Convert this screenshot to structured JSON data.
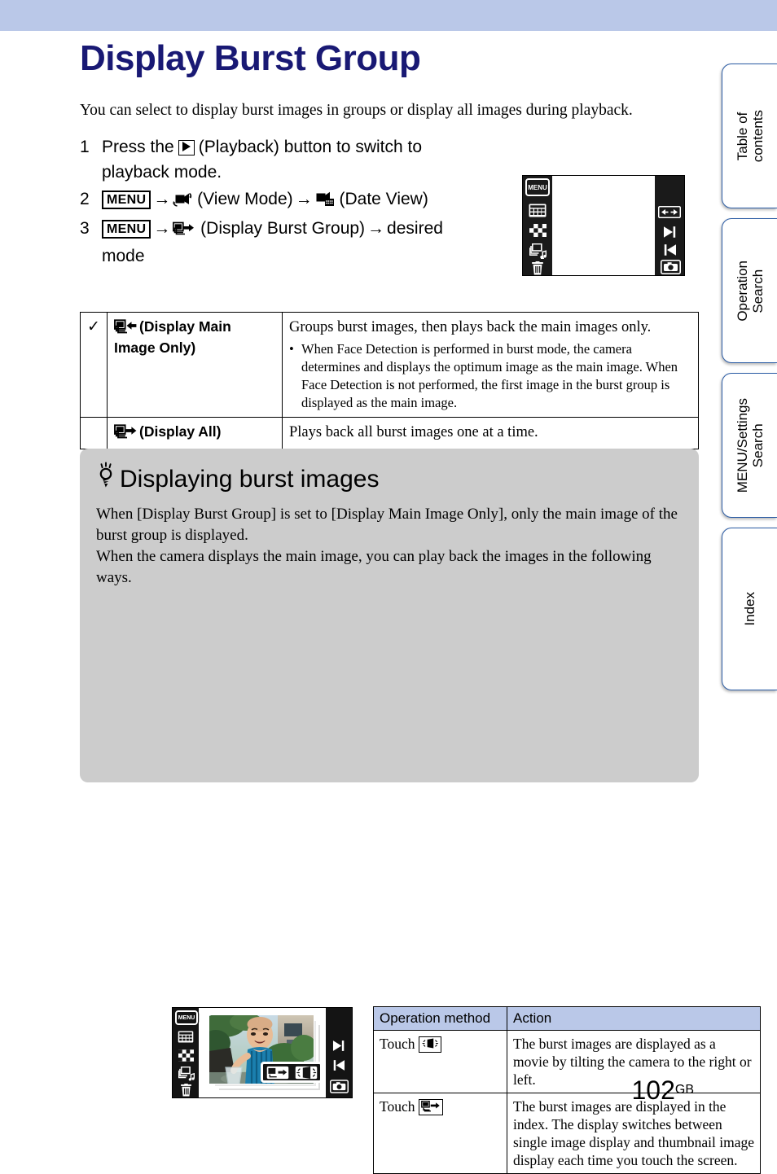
{
  "document": {
    "title": "Display Burst Group",
    "intro": "You can select to display burst images in groups or display all images during playback.",
    "page_number": "102",
    "page_suffix": "GB"
  },
  "side_tabs": [
    {
      "label": "Table of\ncontents"
    },
    {
      "label": "Operation\nSearch"
    },
    {
      "label": "MENU/Settings\nSearch"
    },
    {
      "label": "Index"
    }
  ],
  "steps": [
    {
      "num": "1",
      "line1_a": "Press the",
      "icon1": "playback-icon",
      "line1_b": "(Playback) button to switch to",
      "line2": "playback mode."
    },
    {
      "num": "2",
      "menu_label": "MENU",
      "arrow": "→",
      "icon1": "view-mode-icon",
      "label1": "(View Mode)",
      "icon2": "date-view-icon",
      "label2": "(Date View)"
    },
    {
      "num": "3",
      "menu_label": "MENU",
      "arrow": "→",
      "icon1": "display-burst-group-icon",
      "label1": "(Display Burst Group)",
      "tail": "desired",
      "line2": "mode"
    }
  ],
  "camera_screen_top": {
    "menu_chip": "MENU",
    "left_icons": [
      "menu-icon",
      "date-view-icon",
      "index-view-icon",
      "slideshow-icon",
      "delete-icon"
    ],
    "right_icons": [
      "left-right-arrows-icon",
      "next-image-icon",
      "previous-image-icon",
      "shooting-mode-icon"
    ]
  },
  "options_table": {
    "rows": [
      {
        "checked": "✓",
        "icon": "display-main-image-only-icon",
        "name": "(Display Main Image Only)",
        "desc": "Groups burst images, then plays back the main images only.",
        "bullets": [
          "When Face Detection is performed in burst mode, the camera determines and displays the optimum image as the main image. When Face Detection is not performed, the first image in the burst group is displayed as the main image."
        ]
      },
      {
        "checked": "",
        "icon": "display-all-icon",
        "name": "(Display All)",
        "desc": "Plays back all burst images one at a time.",
        "bullets": []
      }
    ]
  },
  "tip_box": {
    "icon": "lightbulb-icon",
    "heading": "Displaying burst images",
    "paragraph1": "When [Display Burst Group] is set to [Display Main Image Only], only the main image of the burst group is displayed.",
    "paragraph2": "When the camera displays the main image, you can play back the images in the following ways.",
    "camera_screen": {
      "menu_chip": "MENU",
      "left_icons": [
        "menu-icon",
        "date-view-icon",
        "index-view-icon",
        "slideshow-icon",
        "delete-icon"
      ],
      "right_icons": [
        "next-image-icon",
        "previous-image-icon",
        "shooting-mode-icon"
      ],
      "overlay_icons": [
        "display-all-icon",
        "tilt-playback-icon"
      ]
    },
    "operation_table": {
      "headers": [
        "Operation method",
        "Action"
      ],
      "rows": [
        {
          "method_prefix": "Touch",
          "method_icon": "tilt-playback-icon",
          "action": "The burst images are displayed as a movie by tilting the camera to the right or left."
        },
        {
          "method_prefix": "Touch",
          "method_icon": "display-all-icon",
          "action": "The burst images are displayed in the index. The display switches between single image display and thumbnail image display each time you touch the screen."
        }
      ]
    }
  },
  "colors": {
    "header_band": "#bac8e8",
    "title": "#191974",
    "tip_background": "#cccccc",
    "tab_border": "#2b5ca5",
    "table_header": "#bac8e8"
  }
}
